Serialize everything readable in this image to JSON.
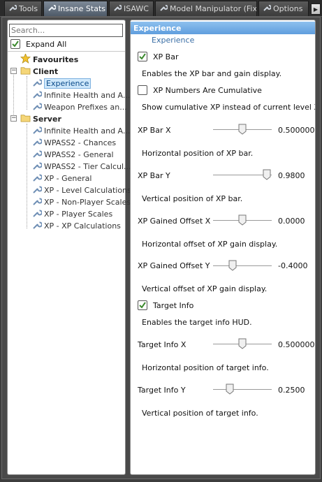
{
  "tabs": [
    {
      "label": "Tools",
      "active": false
    },
    {
      "label": "Insane Stats",
      "active": true
    },
    {
      "label": "ISAWC",
      "active": false
    },
    {
      "label": "Model Manipulator (Fixed)",
      "active": false
    },
    {
      "label": "Options",
      "active": false
    }
  ],
  "sidebar": {
    "search_placeholder": "Search...",
    "expand_all_label": "Expand All",
    "favourites_label": "Favourites",
    "client": {
      "label": "Client",
      "items": [
        "Experience",
        "Infinite Health and A...",
        "Weapon Prefixes an..."
      ]
    },
    "server": {
      "label": "Server",
      "items": [
        "Infinite Health and A...",
        "WPASS2 - Chances",
        "WPASS2 - General",
        "WPASS2 - Tier Calcul...",
        "XP - General",
        "XP - Level Calculations",
        "XP - Non-Player Scales",
        "XP - Player Scales",
        "XP - XP Calculations"
      ]
    }
  },
  "panel": {
    "header": "Experience",
    "subheader": "Experience",
    "xp_bar": {
      "label": "XP Bar",
      "checked": true,
      "desc": "Enables the XP bar and gain display."
    },
    "xp_cumulative": {
      "label": "XP Numbers Are Cumulative",
      "checked": false,
      "desc": "Show cumulative XP instead of current level XP."
    },
    "xp_bar_x": {
      "label": "XP Bar X",
      "value_text": "0.500000",
      "value": 0.5,
      "desc": "Horizontal position of XP bar."
    },
    "xp_bar_y": {
      "label": "XP Bar Y",
      "value_text": "0.9800",
      "value": 0.98,
      "desc": "Vertical position of XP bar."
    },
    "xp_gained_x": {
      "label": "XP Gained Offset X",
      "value_text": "0.0000",
      "value": 0.5,
      "desc": "Horizontal offset of XP gain display."
    },
    "xp_gained_y": {
      "label": "XP Gained Offset Y",
      "value_text": "-0.4000",
      "value": 0.3,
      "desc": "Vertical offset of XP gain display."
    },
    "target_info": {
      "label": "Target Info",
      "checked": true,
      "desc": "Enables the target info HUD."
    },
    "target_x": {
      "label": "Target Info X",
      "value_text": "0.500000",
      "value": 0.5,
      "desc": "Horizontal position of target info."
    },
    "target_y": {
      "label": "Target Info Y",
      "value_text": "0.2500",
      "value": 0.25,
      "desc": "Vertical position of target info."
    }
  },
  "colors": {
    "accent": "#5f9ede",
    "selection": "#cfe8fb",
    "check": "#3c8a2e"
  }
}
